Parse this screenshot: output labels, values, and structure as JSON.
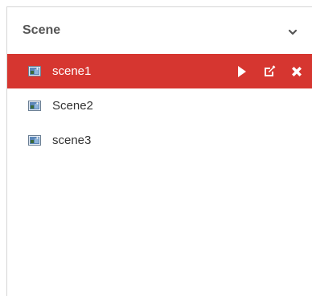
{
  "panel": {
    "title": "Scene",
    "collapse_icon": "chevron-down-icon"
  },
  "scenes": [
    {
      "label": "scene1",
      "selected": true,
      "icon": "scene-image-icon"
    },
    {
      "label": "Scene2",
      "selected": false,
      "icon": "scene-image-icon"
    },
    {
      "label": "scene3",
      "selected": false,
      "icon": "scene-image-icon"
    }
  ],
  "actions": {
    "play_icon": "play-icon",
    "edit_icon": "edit-icon",
    "delete_icon": "close-icon"
  },
  "colors": {
    "selected_background": "#d63630",
    "title_text": "#555555",
    "item_text": "#333333"
  }
}
